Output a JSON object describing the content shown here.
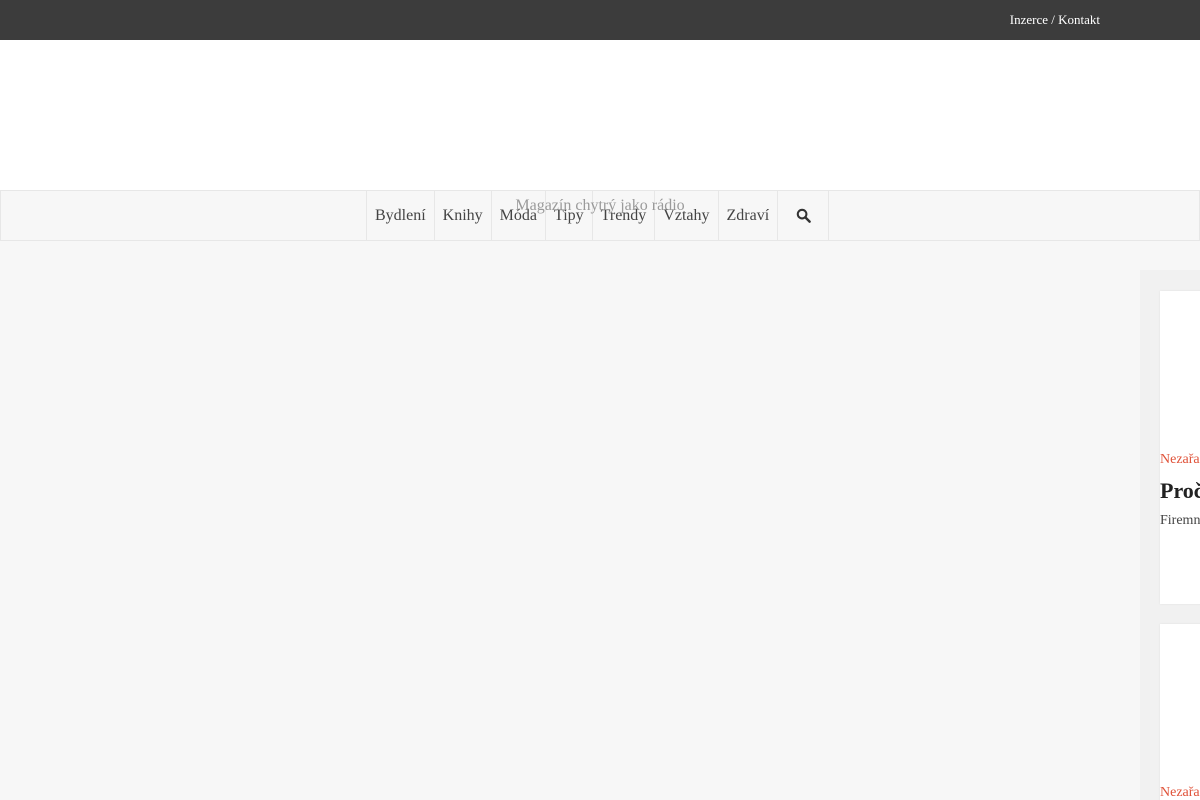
{
  "topbar": {
    "link_label": "Inzerce / Kontakt"
  },
  "header": {
    "tagline": "Magazín chytrý jako rádio"
  },
  "nav": {
    "items": [
      {
        "label": "Bydlení"
      },
      {
        "label": "Knihy"
      },
      {
        "label": "Móda"
      },
      {
        "label": "Tipy"
      },
      {
        "label": "Trendy"
      },
      {
        "label": "Vztahy"
      },
      {
        "label": "Zdraví"
      }
    ],
    "search_icon": "search-icon"
  },
  "sidebar": {
    "cards": [
      {
        "category": "Nezařa",
        "title": "Proč vlast větši",
        "excerpt": "Firemn o láhev"
      },
      {
        "category": "Nezařa"
      }
    ]
  },
  "colors": {
    "topbar_bg": "#3c3c3c",
    "accent": "#e0533a",
    "page_bg": "#f7f7f7"
  }
}
